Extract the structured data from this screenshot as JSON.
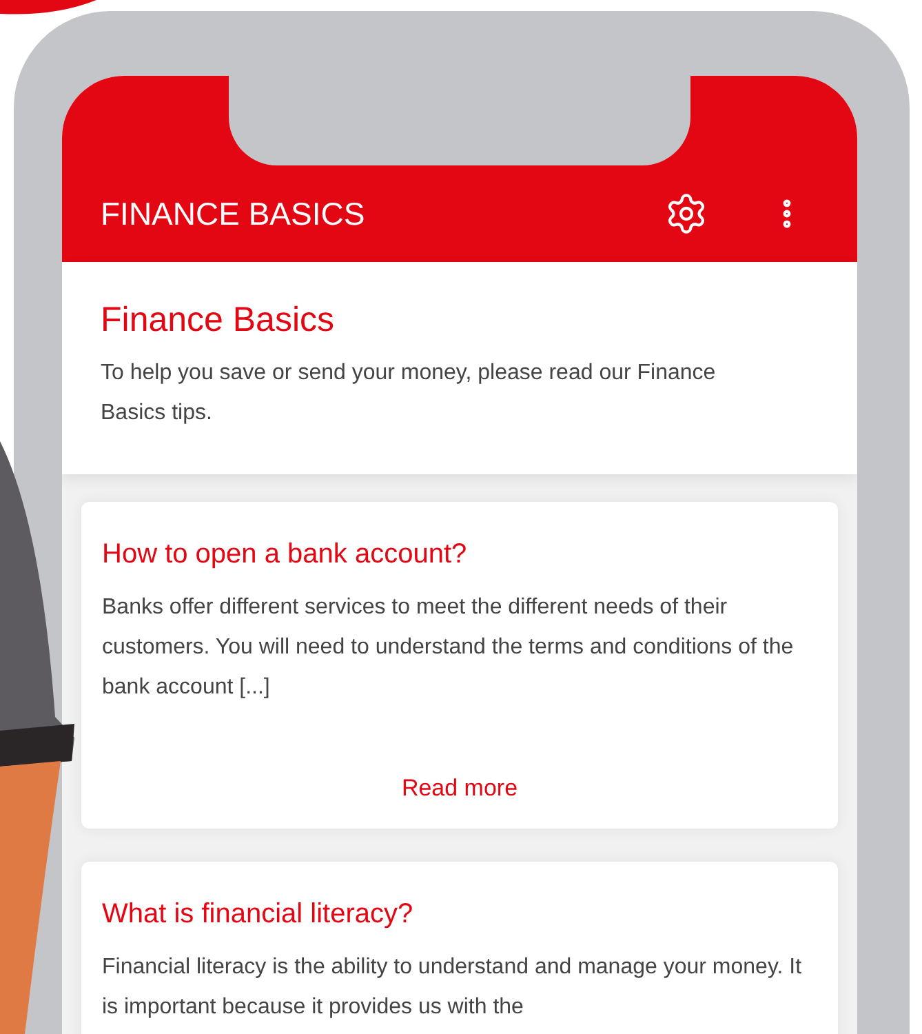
{
  "app_bar": {
    "title": "FINANCE BASICS"
  },
  "intro": {
    "title": "Finance Basics",
    "text": "To help you save or send your money, please read our Finance Basics tips."
  },
  "articles": [
    {
      "title": "How to open a bank account?",
      "text": "Banks offer different services to meet the different needs of their customers. You will need to understand the terms and conditions of the bank account [...]",
      "link": "Read more"
    },
    {
      "title": "What is financial literacy?",
      "text": "Financial literacy is the ability to understand and manage your money. It is important because it provides us with the"
    }
  ]
}
